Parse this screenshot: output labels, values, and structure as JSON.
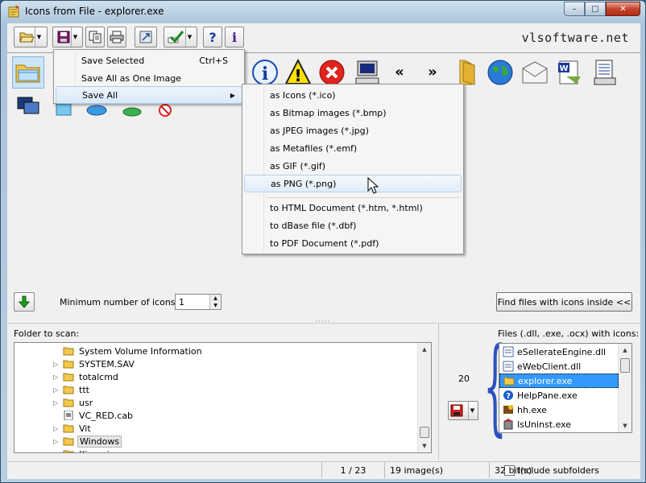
{
  "window": {
    "title": "Icons from File - explorer.exe",
    "brand": "vlsoftware.net",
    "controls": {
      "minimize": "–",
      "maximize": "□",
      "close": "✕"
    }
  },
  "toolbar": {
    "buttons": [
      "open-icon",
      "save-icon",
      "copy-icon",
      "print-icon",
      "resize-icon",
      "select-icon",
      "help-icon",
      "info-icon"
    ]
  },
  "icons": [
    "explorer-folder-icon",
    "info-icon",
    "warning-icon",
    "error-icon",
    "computer-icon",
    "rewind-icon",
    "forward-icon",
    "folder-icon",
    "globe-icon",
    "mail-icon",
    "word-doc-icon",
    "text-doc-icon",
    "network-icon",
    "network-places-icon",
    "ie-globe-icon",
    "users-icon",
    "no-entry-icon"
  ],
  "menu": {
    "items": [
      {
        "label": "Save Selected",
        "shortcut": "Ctrl+S"
      },
      {
        "label": "Save All as One Image",
        "shortcut": ""
      },
      {
        "label": "Save All",
        "shortcut": "",
        "submenu_arrow": "▶"
      }
    ]
  },
  "submenu": {
    "items": [
      "as Icons (*.ico)",
      "as Bitmap images (*.bmp)",
      "as JPEG images (*.jpg)",
      "as Metafiles (*.emf)",
      "as GIF (*.gif)",
      "as PNG (*.png)",
      "to HTML Document (*.htm, *.html)",
      "to dBase file (*.dbf)",
      "to PDF Document (*.pdf)"
    ],
    "highlighted_index": 5
  },
  "filter": {
    "min_icons_label": "Minimum number of icons:",
    "min_icons_value": "1",
    "find_button": "Find files with icons inside <<"
  },
  "folder_panel": {
    "label": "Folder to scan:",
    "items": [
      {
        "label": "System Volume Information",
        "expander": "",
        "type": "folder"
      },
      {
        "label": "SYSTEM.SAV",
        "expander": "▷",
        "type": "folder"
      },
      {
        "label": "totalcmd",
        "expander": "▷",
        "type": "folder"
      },
      {
        "label": "ttt",
        "expander": "▷",
        "type": "folder"
      },
      {
        "label": "usr",
        "expander": "▷",
        "type": "folder"
      },
      {
        "label": "VC_RED.cab",
        "expander": "",
        "type": "file"
      },
      {
        "label": "Vit",
        "expander": "▷",
        "type": "folder"
      },
      {
        "label": "Windows",
        "expander": "▷",
        "type": "folder",
        "selected": true
      },
      {
        "label": "Xiaomi",
        "expander": "▷",
        "type": "folder"
      }
    ]
  },
  "files_panel": {
    "label": "Files (.dll, .exe, .ocx) with icons:",
    "count": "20",
    "items": [
      {
        "label": "eSellerateEngine.dll",
        "type": "dll"
      },
      {
        "label": "eWebClient.dll",
        "type": "dll"
      },
      {
        "label": "explorer.exe",
        "type": "exe",
        "selected": true
      },
      {
        "label": "HelpPane.exe",
        "type": "help"
      },
      {
        "label": "hh.exe",
        "type": "help-book"
      },
      {
        "label": "IsUninst.exe",
        "type": "uninstall"
      }
    ],
    "include_subfolders": "Include subfolders"
  },
  "status": {
    "position": "1 / 23",
    "images": "19 image(s)",
    "depth": "32 bit(s)"
  }
}
